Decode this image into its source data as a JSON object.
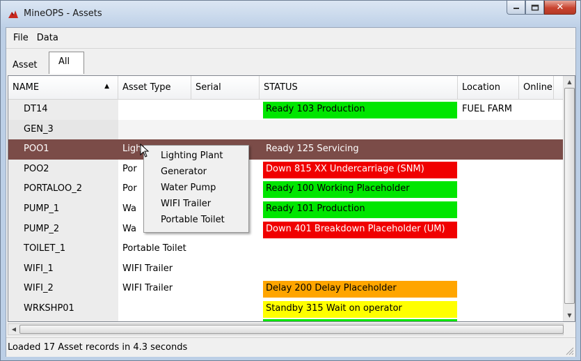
{
  "window": {
    "title": "MineOPS - Assets"
  },
  "menu": [
    "File",
    "Data"
  ],
  "tabs": {
    "asset": "Asset",
    "all": "All"
  },
  "columns": {
    "name": "NAME",
    "type": "Asset Type",
    "serial": "Serial",
    "status": "STATUS",
    "location": "Location",
    "online": "Online"
  },
  "rows": [
    {
      "name": "DT14",
      "type": "",
      "status": "Ready 103 Production",
      "status_color": "#00e600",
      "location": "FUEL FARM"
    },
    {
      "name": "GEN_3",
      "type": "",
      "status": "",
      "status_color": "",
      "location": ""
    },
    {
      "name": "POO1",
      "type": "Ligh",
      "status": "Ready 125 Servicing",
      "status_color": "",
      "location": ""
    },
    {
      "name": "POO2",
      "type": "Por",
      "status": "Down 815 XX Undercarriage (SNM)",
      "status_color": "#f00000",
      "location": ""
    },
    {
      "name": "PORTALOO_2",
      "type": "Por",
      "status": "Ready 100 Working Placeholder",
      "status_color": "#00e600",
      "location": ""
    },
    {
      "name": "PUMP_1",
      "type": "Wa",
      "status": "Ready 101 Production",
      "status_color": "#00e600",
      "location": ""
    },
    {
      "name": "PUMP_2",
      "type": "Wa",
      "status": "Down 401 Breakdown Placeholder (UM)",
      "status_color": "#f00000",
      "location": ""
    },
    {
      "name": "TOILET_1",
      "type": "Portable Toilet",
      "status": "",
      "status_color": "",
      "location": ""
    },
    {
      "name": "WIFI_1",
      "type": "WIFI Trailer",
      "status": "",
      "status_color": "",
      "location": ""
    },
    {
      "name": "WIFI_2",
      "type": "WIFI Trailer",
      "status": "Delay 200 Delay Placeholder",
      "status_color": "#ffa500",
      "location": ""
    },
    {
      "name": "WRKSHP01",
      "type": "",
      "status": "Standby 315 Wait on operator",
      "status_color": "#ffff00",
      "location": ""
    }
  ],
  "context_menu": [
    "Lighting Plant",
    "Generator",
    "Water Pump",
    "WIFI Trailer",
    "Portable Toilet"
  ],
  "status_bar": {
    "text": "Loaded 17 Asset records in 4.3 seconds"
  },
  "colors": {
    "selected_row": "#7b4c48",
    "ready": "#00e600",
    "down": "#f00000",
    "delay": "#ffa500",
    "standby": "#ffff00"
  }
}
